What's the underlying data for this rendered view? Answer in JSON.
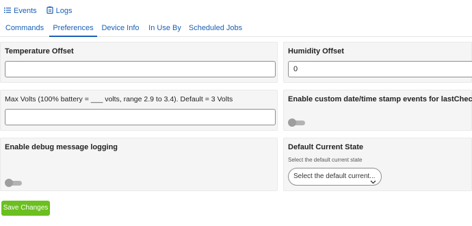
{
  "links": {
    "events_label": "Events",
    "logs_label": "Logs"
  },
  "tabs": [
    {
      "label": "Commands"
    },
    {
      "label": "Preferences"
    },
    {
      "label": "Device Info"
    },
    {
      "label": "In Use By"
    },
    {
      "label": "Scheduled Jobs"
    }
  ],
  "active_tab": "Preferences",
  "preferences": {
    "temperature_offset": {
      "label": "Temperature Offset",
      "value": ""
    },
    "humidity_offset": {
      "label": "Humidity Offset",
      "value": "0"
    },
    "max_volts": {
      "label": "Max Volts (100% battery = ___ volts, range 2.9 to 3.4). Default = 3 Volts",
      "value": ""
    },
    "custom_timestamp": {
      "label": "Enable custom date/time stamp events for lastCheckin",
      "enabled": false
    },
    "debug_logging": {
      "label": "Enable debug message logging",
      "enabled": false
    },
    "default_state": {
      "label": "Default Current State",
      "hint": "Select the default current state",
      "selected": "Select the default current..."
    }
  },
  "save_button_label": "Save Changes",
  "colors": {
    "link": "#1a5fb4",
    "save_button": "#6bbf1f",
    "card_background": "#f5f5f5"
  },
  "icons": {
    "events": "list-icon",
    "logs": "clipboard-icon",
    "select": "chevron-down-icon"
  }
}
